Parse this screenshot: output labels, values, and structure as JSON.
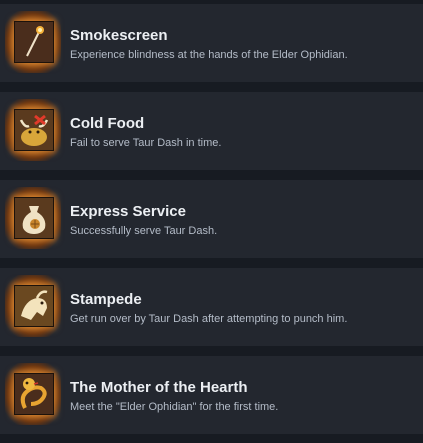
{
  "achievements": [
    {
      "title": "Smokescreen",
      "description": "Experience blindness at the hands of the Elder Ophidian.",
      "icon": "smoke-torch-icon"
    },
    {
      "title": "Cold Food",
      "description": "Fail to serve Taur Dash in time.",
      "icon": "minotaur-plate-icon"
    },
    {
      "title": "Express Service",
      "description": "Successfully serve Taur Dash.",
      "icon": "food-sack-icon"
    },
    {
      "title": "Stampede",
      "description": "Get run over by Taur Dash after attempting to punch him.",
      "icon": "charging-minotaur-icon"
    },
    {
      "title": "The Mother of the Hearth",
      "description": "Meet the \"Elder Ophidian\" for the first time.",
      "icon": "golden-serpent-icon"
    }
  ],
  "colors": {
    "background": "#171b22",
    "row": "#23272f",
    "title": "#eceff3",
    "description": "#b4bcc8",
    "glow": "#f3a646"
  }
}
